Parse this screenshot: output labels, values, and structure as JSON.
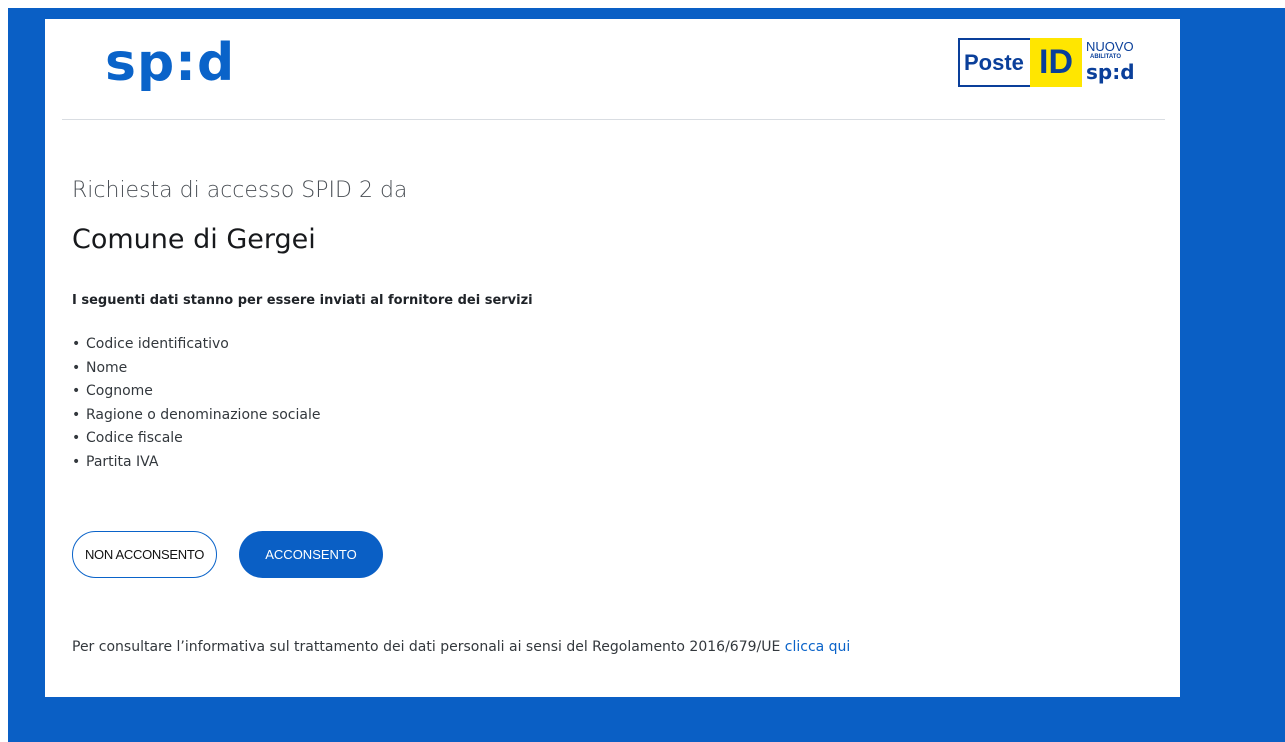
{
  "header": {
    "spid_logo_text": "sp:d",
    "provider_logo": {
      "poste": "Poste",
      "id": "ID",
      "nuovo": "NUOVO",
      "abilitato": "ABILITATO",
      "spid": "sp:d"
    }
  },
  "main": {
    "request_label": "Richiesta di accesso SPID 2 da",
    "service_provider": "Comune di Gergei",
    "intro": "I seguenti dati stanno per essere inviati al fornitore dei servizi",
    "attributes": [
      "Codice identificativo",
      "Nome",
      "Cognome",
      "Ragione o denominazione sociale",
      "Codice fiscale",
      "Partita IVA"
    ],
    "buttons": {
      "deny": "NON ACCONSENTO",
      "consent": "ACCONSENTO"
    },
    "privacy": {
      "text": "Per consultare l’informativa sul trattamento dei dati personali ai sensi del Regolamento 2016/679/UE ",
      "link": "clicca qui"
    }
  },
  "colors": {
    "brand_blue": "#0a5fc5",
    "poste_yellow": "#ffe600",
    "poste_navy": "#0a3f9a"
  }
}
